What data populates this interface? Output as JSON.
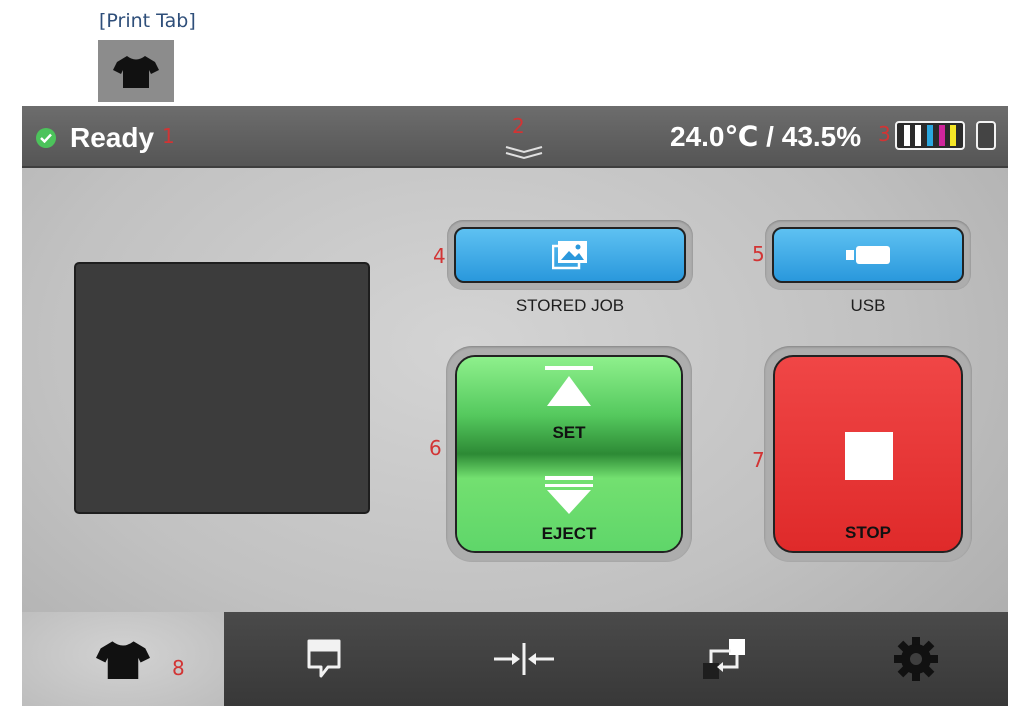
{
  "caption": {
    "text": "[Print Tab]",
    "thumb_icon": "tshirt-icon"
  },
  "status": {
    "state": "Ready",
    "state_icon": "check-circle-icon",
    "state_color": "#4cc35b",
    "pulldown_icon": "double-chevron-down-icon",
    "environment": "24.0℃ / 43.5%",
    "ink_icon": "ink-level-icon",
    "ink_colors": [
      "#ffffff",
      "#ffffff",
      "#2aa7df",
      "#d0259b",
      "#f4e526"
    ],
    "maintenance_icon": "maintenance-cartridge-icon"
  },
  "callouts": {
    "c1": "1",
    "c2": "2",
    "c3": "3",
    "c4": "4",
    "c5": "5",
    "c6": "6",
    "c7": "7",
    "c8": "8"
  },
  "buttons": {
    "stored_job": {
      "label": "STORED JOB",
      "icon": "image-gallery-icon"
    },
    "usb": {
      "label": "USB",
      "icon": "usb-drive-icon"
    },
    "set": {
      "label": "SET",
      "icon": "triangle-up-icon"
    },
    "eject": {
      "label": "EJECT",
      "icon": "triangle-down-icon"
    },
    "stop": {
      "label": "STOP",
      "icon": "stop-square-icon",
      "color": "#e63232"
    }
  },
  "nav": {
    "tabs": [
      {
        "name": "print",
        "icon": "tshirt-icon",
        "active": true
      },
      {
        "name": "message",
        "icon": "speech-bubble-icon",
        "active": false
      },
      {
        "name": "alignment",
        "icon": "align-arrows-icon",
        "active": false
      },
      {
        "name": "transfer",
        "icon": "transfer-arrows-icon",
        "active": false
      },
      {
        "name": "settings",
        "icon": "gear-icon",
        "active": false
      }
    ]
  }
}
